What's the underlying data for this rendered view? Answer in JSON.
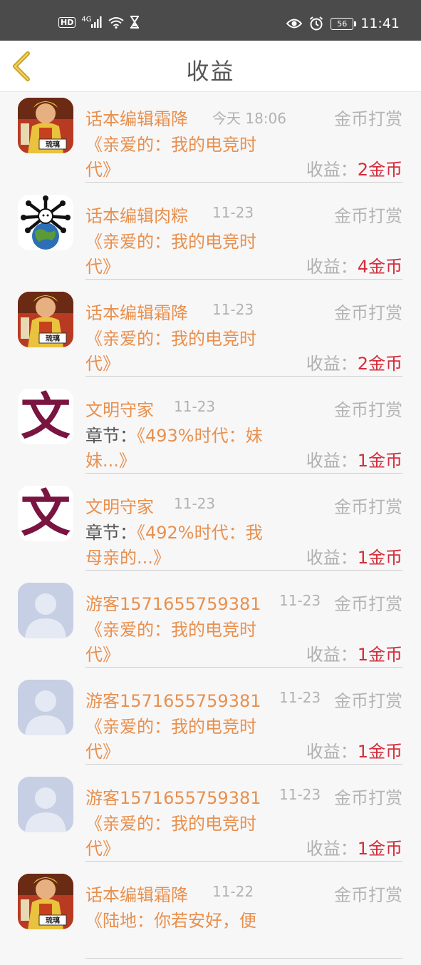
{
  "status_bar": {
    "hd": "HD",
    "network": "4G",
    "battery": "56",
    "time": "11:41"
  },
  "header": {
    "title": "收益"
  },
  "items": [
    {
      "avatar": "monk",
      "name": "话本编辑霜降",
      "date": "今天 18:06",
      "type": "金币打赏",
      "prefix": "",
      "line1": "《亲爱的：我的电竞时",
      "line2": "代》",
      "income_label": "收益：",
      "income_amount": "2金币"
    },
    {
      "avatar": "globe",
      "name": "话本编辑肉粽",
      "date": "11-23",
      "type": "金币打赏",
      "prefix": "",
      "line1": "《亲爱的：我的电竞时",
      "line2": "代》",
      "income_label": "收益：",
      "income_amount": "4金币"
    },
    {
      "avatar": "monk",
      "name": "话本编辑霜降",
      "date": "11-23",
      "type": "金币打赏",
      "prefix": "",
      "line1": "《亲爱的：我的电竞时",
      "line2": "代》",
      "income_label": "收益：",
      "income_amount": "2金币"
    },
    {
      "avatar": "wen",
      "avatar_char": "文",
      "name": "文明守家",
      "date": "11-23",
      "type": "金币打赏",
      "prefix": "章节：",
      "line1": "《493%时代：妹",
      "line2": "妹...》",
      "income_label": "收益：",
      "income_amount": "1金币"
    },
    {
      "avatar": "wen",
      "avatar_char": "文",
      "name": "文明守家",
      "date": "11-23",
      "type": "金币打赏",
      "prefix": "章节：",
      "line1": "《492%时代：我",
      "line2": "母亲的...》",
      "income_label": "收益：",
      "income_amount": "1金币"
    },
    {
      "avatar": "guest",
      "name": "游客1571655759381",
      "date": "11-23",
      "type": "金币打赏",
      "prefix": "",
      "line1": "《亲爱的：我的电竞时",
      "line2": "代》",
      "income_label": "收益：",
      "income_amount": "1金币"
    },
    {
      "avatar": "guest",
      "name": "游客1571655759381",
      "date": "11-23",
      "type": "金币打赏",
      "prefix": "",
      "line1": "《亲爱的：我的电竞时",
      "line2": "代》",
      "income_label": "收益：",
      "income_amount": "1金币"
    },
    {
      "avatar": "guest",
      "name": "游客1571655759381",
      "date": "11-23",
      "type": "金币打赏",
      "prefix": "",
      "line1": "《亲爱的：我的电竞时",
      "line2": "代》",
      "income_label": "收益：",
      "income_amount": "1金币"
    },
    {
      "avatar": "monk",
      "name": "话本编辑霜降",
      "date": "11-22",
      "type": "金币打赏",
      "prefix": "",
      "line1": "《陆地：你若安好，便",
      "line2": "",
      "income_label": "",
      "income_amount": ""
    }
  ],
  "colors": {
    "accent_orange": "#e8904e",
    "amount_red": "#d32d3a",
    "status_bar": "#4b4b4b",
    "back_arrow": "#c9a22a"
  }
}
